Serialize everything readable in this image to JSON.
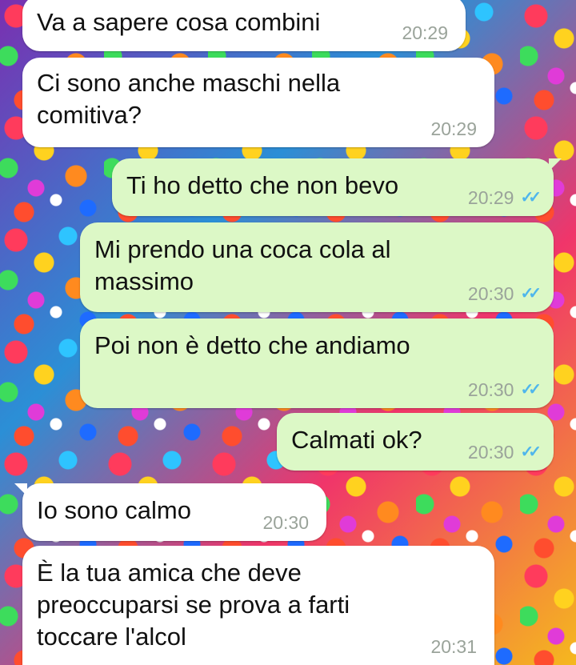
{
  "messages": [
    {
      "direction": "incoming",
      "text": "Va a sapere cosa combini",
      "time": "20:29"
    },
    {
      "direction": "incoming",
      "text": "Ci sono anche maschi nella\ncomitiva?",
      "time": "20:29"
    },
    {
      "direction": "outgoing",
      "text": "Ti ho detto che non bevo",
      "time": "20:29",
      "status_icon": "double-check-icon"
    },
    {
      "direction": "outgoing",
      "text": "Mi prendo una coca cola al\nmassimo",
      "time": "20:30",
      "status_icon": "double-check-icon"
    },
    {
      "direction": "outgoing",
      "text": "Poi non è detto che andiamo",
      "time": "20:30",
      "status_icon": "double-check-icon"
    },
    {
      "direction": "outgoing",
      "text": "Calmati ok?",
      "time": "20:30",
      "status_icon": "double-check-icon"
    },
    {
      "direction": "incoming",
      "text": "Io sono calmo",
      "time": "20:30"
    },
    {
      "direction": "incoming",
      "text": "È la tua amica che deve\npreoccuparsi se prova a farti\ntoccare l'alcol",
      "time": "20:31"
    }
  ],
  "colors": {
    "incoming_bubble": "#ffffff",
    "outgoing_bubble": "#dcf8c6",
    "read_ticks": "#4fb6ec",
    "timestamp": "#9aa39a"
  }
}
